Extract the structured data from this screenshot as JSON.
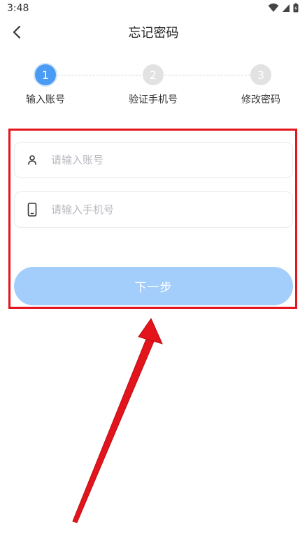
{
  "status_bar": {
    "time": "3:48"
  },
  "header": {
    "title": "忘记密码"
  },
  "stepper": {
    "steps": [
      {
        "number": "1",
        "label": "输入账号",
        "active": true
      },
      {
        "number": "2",
        "label": "验证手机号",
        "active": false
      },
      {
        "number": "3",
        "label": "修改密码",
        "active": false
      }
    ]
  },
  "form": {
    "account_placeholder": "请输入账号",
    "account_value": "",
    "phone_placeholder": "请输入手机号",
    "phone_value": "",
    "next_label": "下一步"
  },
  "colors": {
    "accent": "#4a9bf3",
    "button_disabled": "#a3cdfb",
    "annotation_red": "#e3141c"
  }
}
